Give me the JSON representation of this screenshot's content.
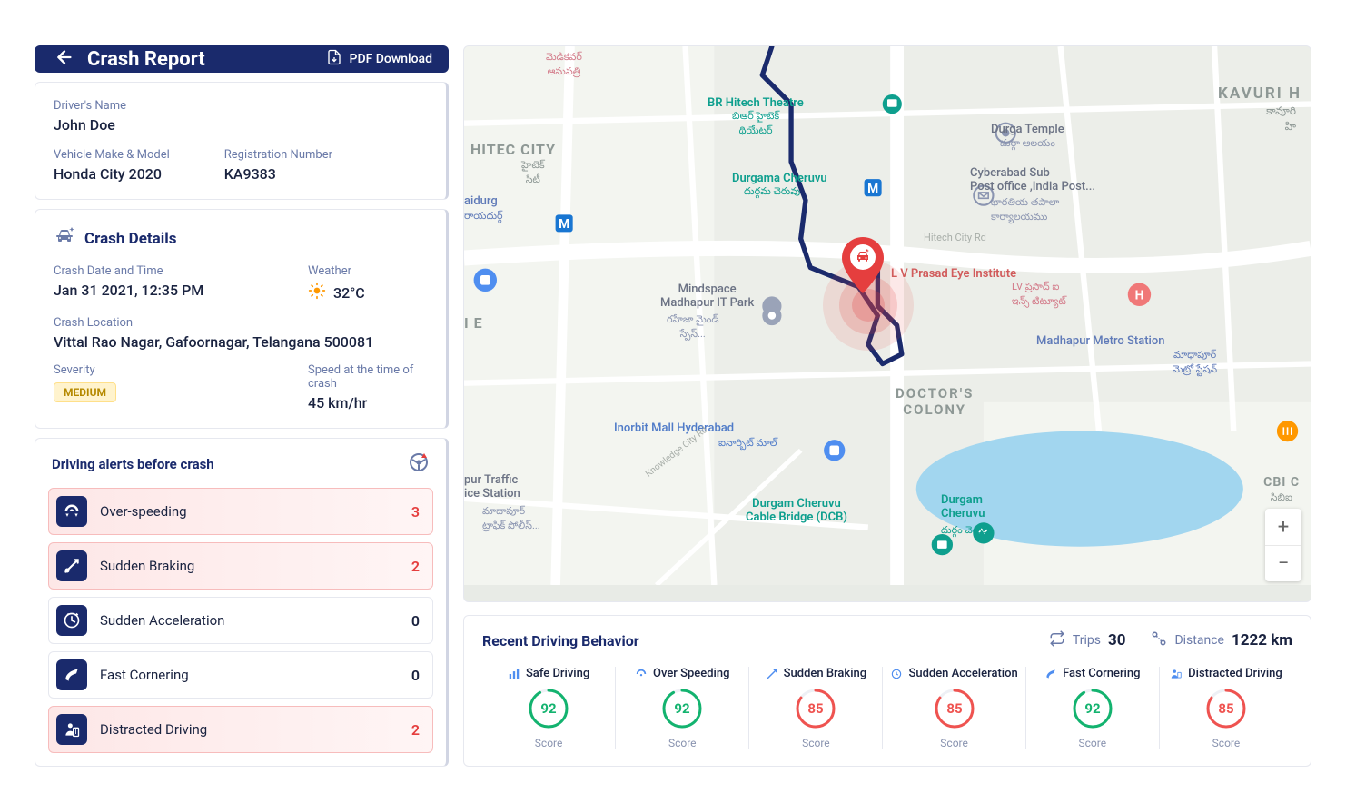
{
  "header": {
    "title": "Crash Report",
    "pdf_label": "PDF Download"
  },
  "driver": {
    "name_label": "Driver's Name",
    "name": "John Doe",
    "vehicle_label": "Vehicle Make & Model",
    "vehicle": "Honda City 2020",
    "reg_label": "Registration Number",
    "reg": "KA9383"
  },
  "crash": {
    "section_title": "Crash Details",
    "datetime_label": "Crash Date and Time",
    "datetime": "Jan 31 2021, 12:35 PM",
    "weather_label": "Weather",
    "weather": "32°C",
    "location_label": "Crash Location",
    "location": "Vittal Rao Nagar, Gafoornagar, Telangana 500081",
    "severity_label": "Severity",
    "severity": "MEDIUM",
    "speed_label": "Speed at the time of crash",
    "speed": "45 km/hr"
  },
  "alerts": {
    "section_title": "Driving alerts  before crash",
    "items": [
      {
        "label": "Over-speeding",
        "count": "3",
        "highlight": true
      },
      {
        "label": "Sudden Braking",
        "count": "2",
        "highlight": true
      },
      {
        "label": "Sudden Acceleration",
        "count": "0",
        "highlight": false
      },
      {
        "label": "Fast Cornering",
        "count": "0",
        "highlight": false
      },
      {
        "label": "Distracted Driving",
        "count": "2",
        "highlight": true
      }
    ]
  },
  "map": {
    "labels": {
      "hitec_city": "HITEC CITY",
      "hitec_sub": "హైటెక్\nసిటీ",
      "br_theatre": "BR Hitech Theatre",
      "br_theatre_sub": "బిఆర్ హైటెక్\nథియేటర్",
      "medicover": "మెడికవర్\nఆసుపత్రి",
      "durga_temple": "Durga Temple",
      "durga_temple_sub": "దుర్గా ఆలయం",
      "cyberabad_post": "Cyberabad Sub\nPost office ,India Post...",
      "cyberabad_post_sub": "భారతియ తపాలా\nకార్యాలయము",
      "kavuri": "KAVURI H",
      "kavuri_sub": "కావూరి\nహి",
      "durgama": "Durgama Cheruvu",
      "durgama_sub": "దుర్గమ చెరువు",
      "lv_prasad": "L V Prasad Eye Institute",
      "lv_prasad_sub": "LV ప్రసాద్ ఐ\nఇన్స్ టిట్యూట్",
      "madhapur_metro": "Madhapur Metro Station",
      "madhapur_metro_sub": "మాధాపూర్\nమెట్రో స్టేషన్",
      "hitech_rd": "Hitech City Rd",
      "mindspace": "Mindspace\nMadhapur IT Park",
      "mindspace_sub": "రహేజా మైండ్\nస్పేస్...",
      "doctors": "DOCTOR'S\nCOLONY",
      "raidurg": "aidurg",
      "raidurg_sub": "రాయదుర్గ్",
      "inorbit": "Inorbit Mall Hyderabad",
      "inorbit_sub": "ఐనార్బిట్ మాల్",
      "traffic_station": "pur Traffic\nice Station",
      "traffic_station_sub": "మాదాపూర్\nట్రాఫిక్ పోలీస్...",
      "cable_bridge": "Durgam Cheruvu\nCable Bridge (DCB)",
      "durgam": "Durgam\nCheruvu",
      "durgam_sub": "దుర్గం చెరువు",
      "cbi": "CBI C",
      "cbi_sub": "సిబిఐ",
      "knowledge_rd": "Knowledge City Rd",
      "ie": "I E"
    }
  },
  "behavior": {
    "title": "Recent Driving Behavior",
    "trips_label": "Trips",
    "trips": "30",
    "distance_label": "Distance",
    "distance": "1222 km",
    "score_caption": "Score",
    "scores": [
      {
        "label": "Safe Driving",
        "value": "92",
        "good": true
      },
      {
        "label": "Over Speeding",
        "value": "92",
        "good": true
      },
      {
        "label": "Sudden Braking",
        "value": "85",
        "good": false
      },
      {
        "label": "Sudden Acceleration",
        "value": "85",
        "good": false
      },
      {
        "label": "Fast Cornering",
        "value": "92",
        "good": true
      },
      {
        "label": "Distracted Driving",
        "value": "85",
        "good": false
      }
    ]
  },
  "colors": {
    "primary": "#1a2a6c",
    "green": "#13b36f",
    "red": "#ef5350",
    "teal": "#0e9f8e"
  }
}
